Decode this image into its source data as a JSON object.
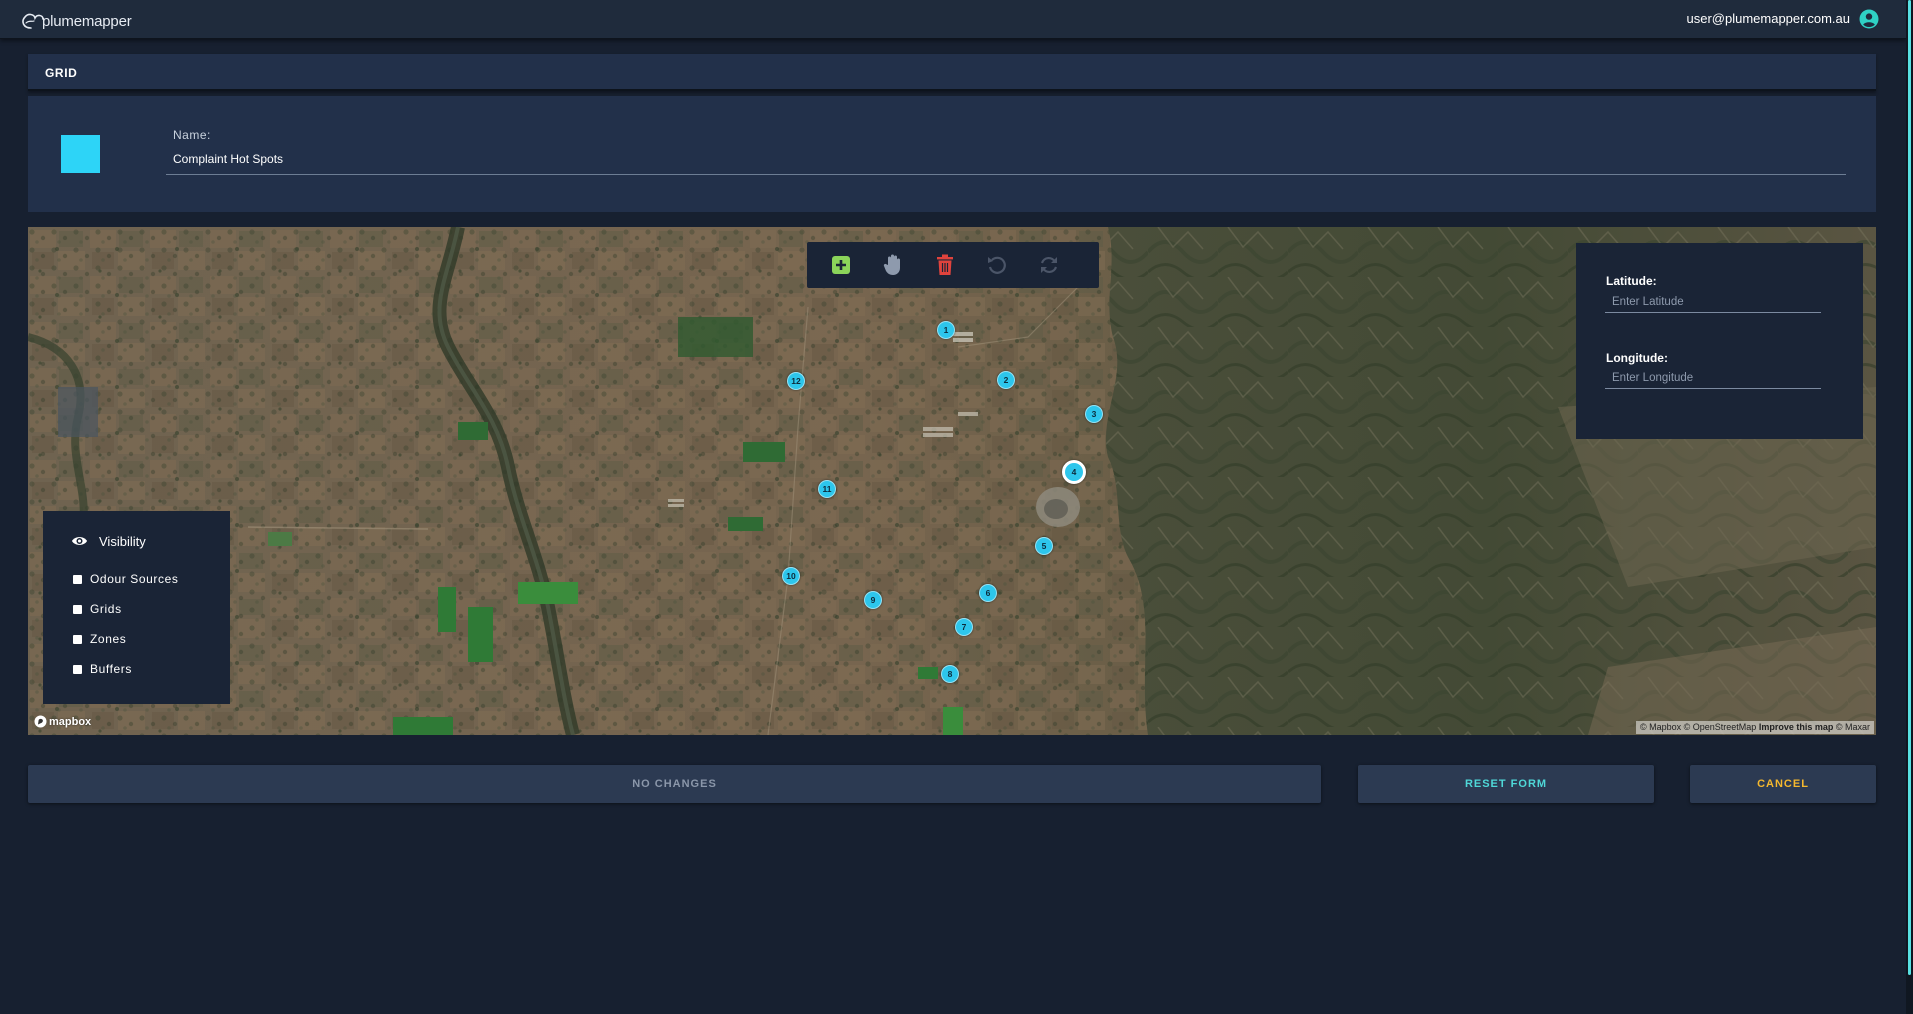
{
  "app": {
    "brand": "plumemapper",
    "user_email": "user@plumemapper.com.au"
  },
  "section": {
    "title": "GRID"
  },
  "form": {
    "swatch_color": "#2dd4f7",
    "name_label": "Name:",
    "name_value": "Complaint Hot Spots"
  },
  "map": {
    "toolbar": {
      "add_icon": "plus-square-icon",
      "pan_icon": "hand-icon",
      "delete_icon": "trash-icon",
      "undo_icon": "undo-icon",
      "redo_icon": "refresh-icon"
    },
    "coordinates": {
      "latitude_label": "Latitude:",
      "latitude_placeholder": "Enter Latitude",
      "longitude_label": "Longitude:",
      "longitude_placeholder": "Enter Longitude"
    },
    "visibility": {
      "title": "Visibility",
      "options": [
        "Odour Sources",
        "Grids",
        "Zones",
        "Buffers"
      ]
    },
    "markers": [
      "1",
      "2",
      "3",
      "4",
      "5",
      "6",
      "7",
      "8",
      "9",
      "10",
      "11",
      "12"
    ],
    "selected_marker": "4",
    "mapbox_logo": "mapbox",
    "attribution": {
      "prefix": "© Mapbox © OpenStreetMap",
      "improve": "Improve this map",
      "suffix": "© Maxar"
    }
  },
  "actions": {
    "no_changes": "NO CHANGES",
    "reset": "RESET FORM",
    "cancel": "CANCEL"
  },
  "colors": {
    "accent_cyan": "#2dd4f7",
    "reset_text": "#4fd8d8",
    "cancel_text": "#f5b82e",
    "add_green": "#8bd45a",
    "delete_red": "#e0433d"
  }
}
